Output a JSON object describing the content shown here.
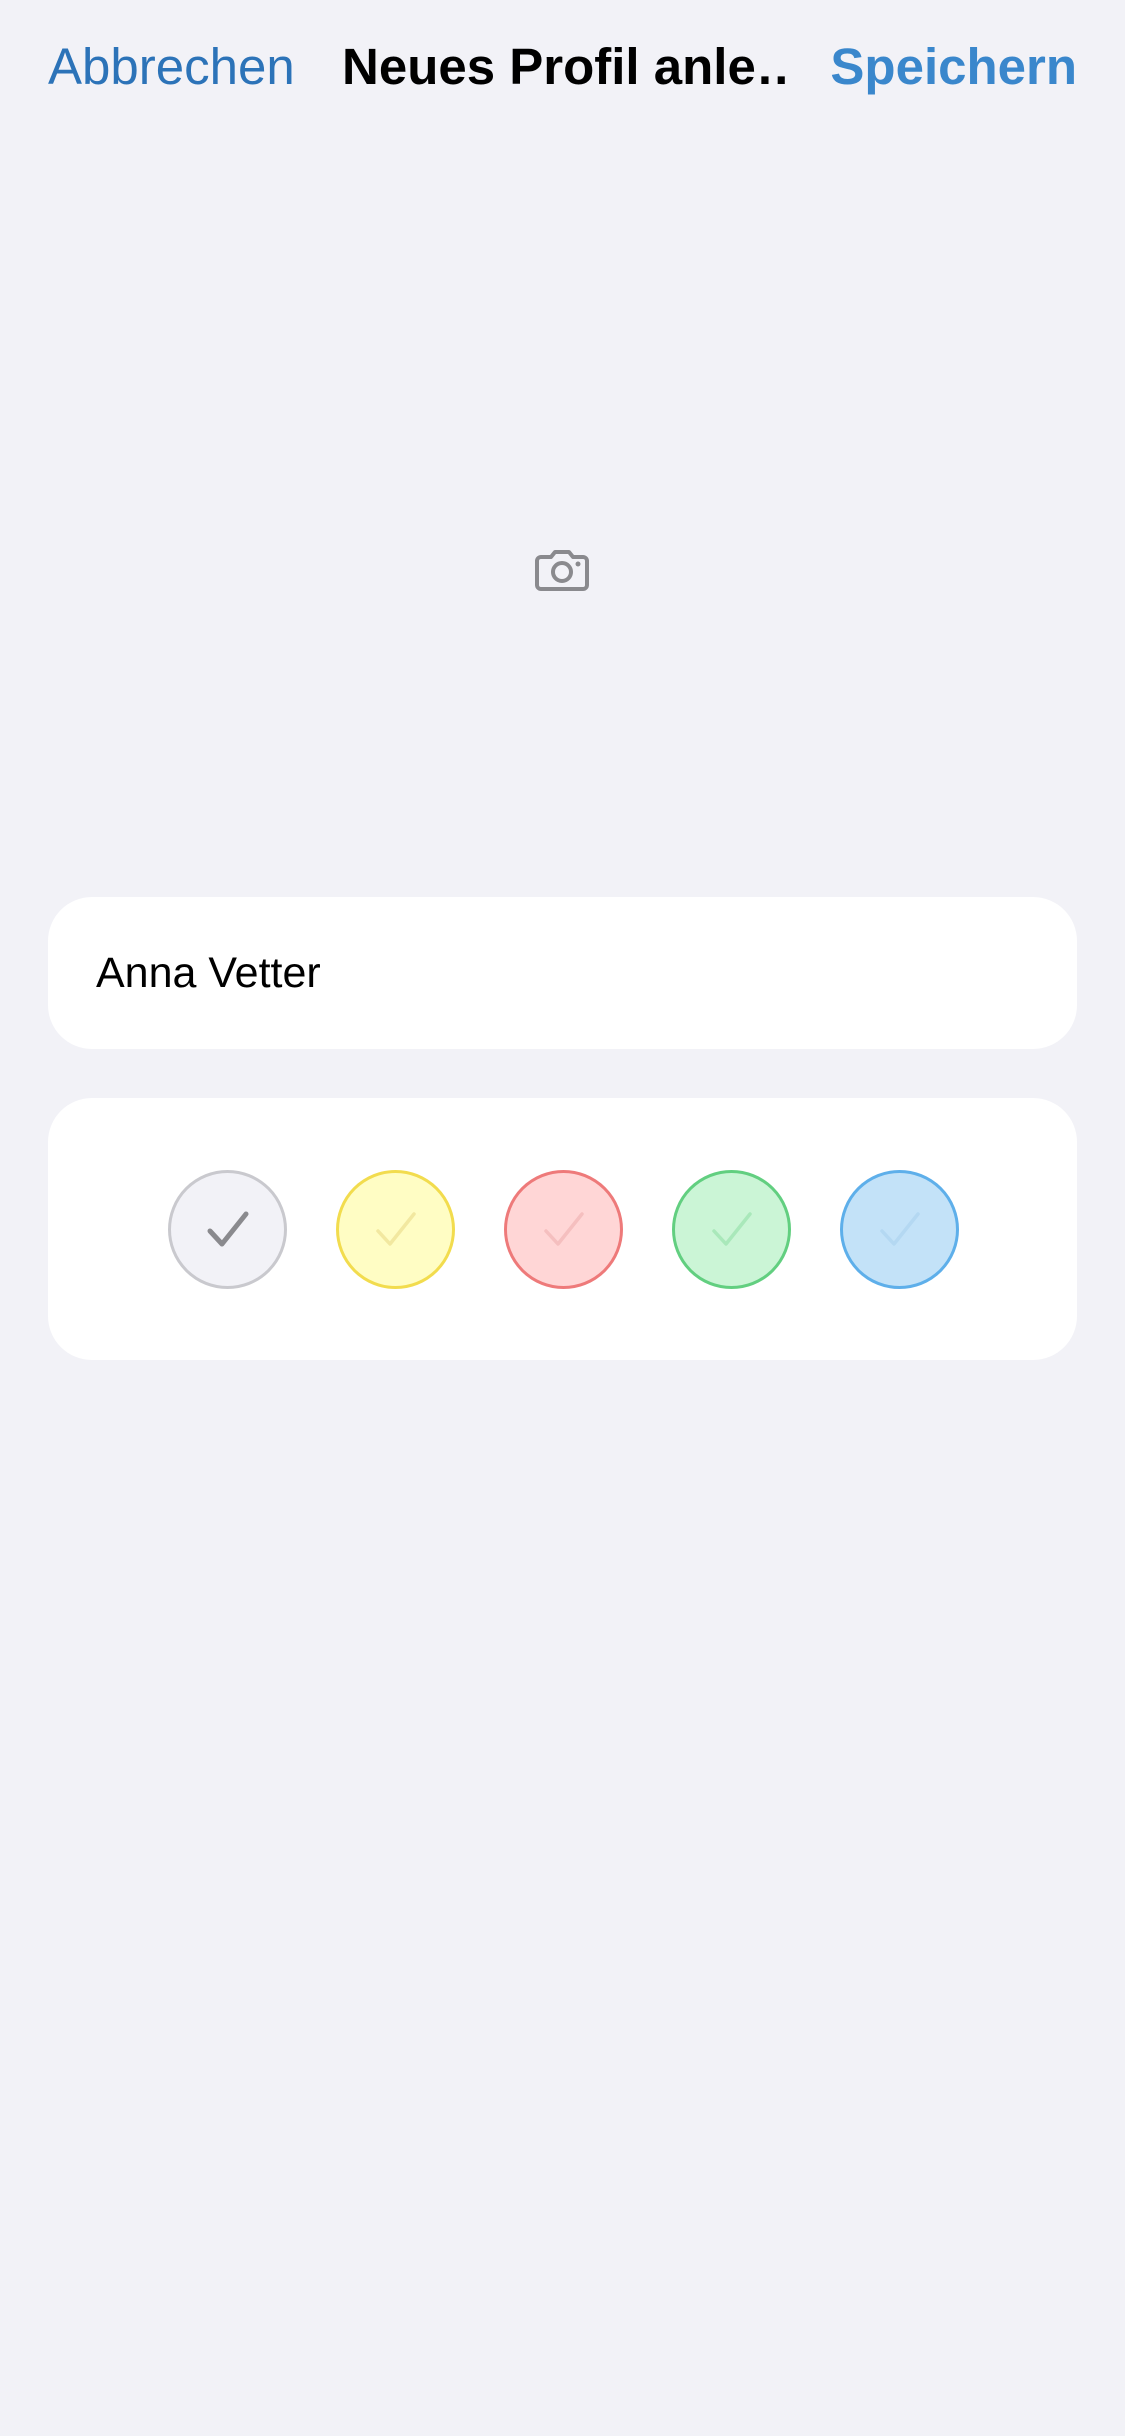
{
  "nav": {
    "cancel_label": "Abbrechen",
    "title": "Neues Profil anle…",
    "save_label": "Speichern"
  },
  "photo": {
    "icon": "camera-icon"
  },
  "name_field": {
    "value": "Anna Vetter"
  },
  "colors": {
    "selected": "gray",
    "options": [
      {
        "name": "gray",
        "fill": "#F2F2F7",
        "border": "#C9C9CE",
        "check": "#8A8A8E",
        "selected": true
      },
      {
        "name": "yellow",
        "fill": "#FFFDC4",
        "border": "#F2DC4E",
        "check": "#F2E8A0",
        "selected": false
      },
      {
        "name": "red",
        "fill": "#FFD6D6",
        "border": "#EE7A7A",
        "check": "#F5BFBF",
        "selected": false
      },
      {
        "name": "green",
        "fill": "#CBF5D6",
        "border": "#62CF80",
        "check": "#A9E8BA",
        "selected": false
      },
      {
        "name": "blue",
        "fill": "#C3E2F8",
        "border": "#5EAFEA",
        "check": "#B4D8F2",
        "selected": false
      }
    ]
  }
}
